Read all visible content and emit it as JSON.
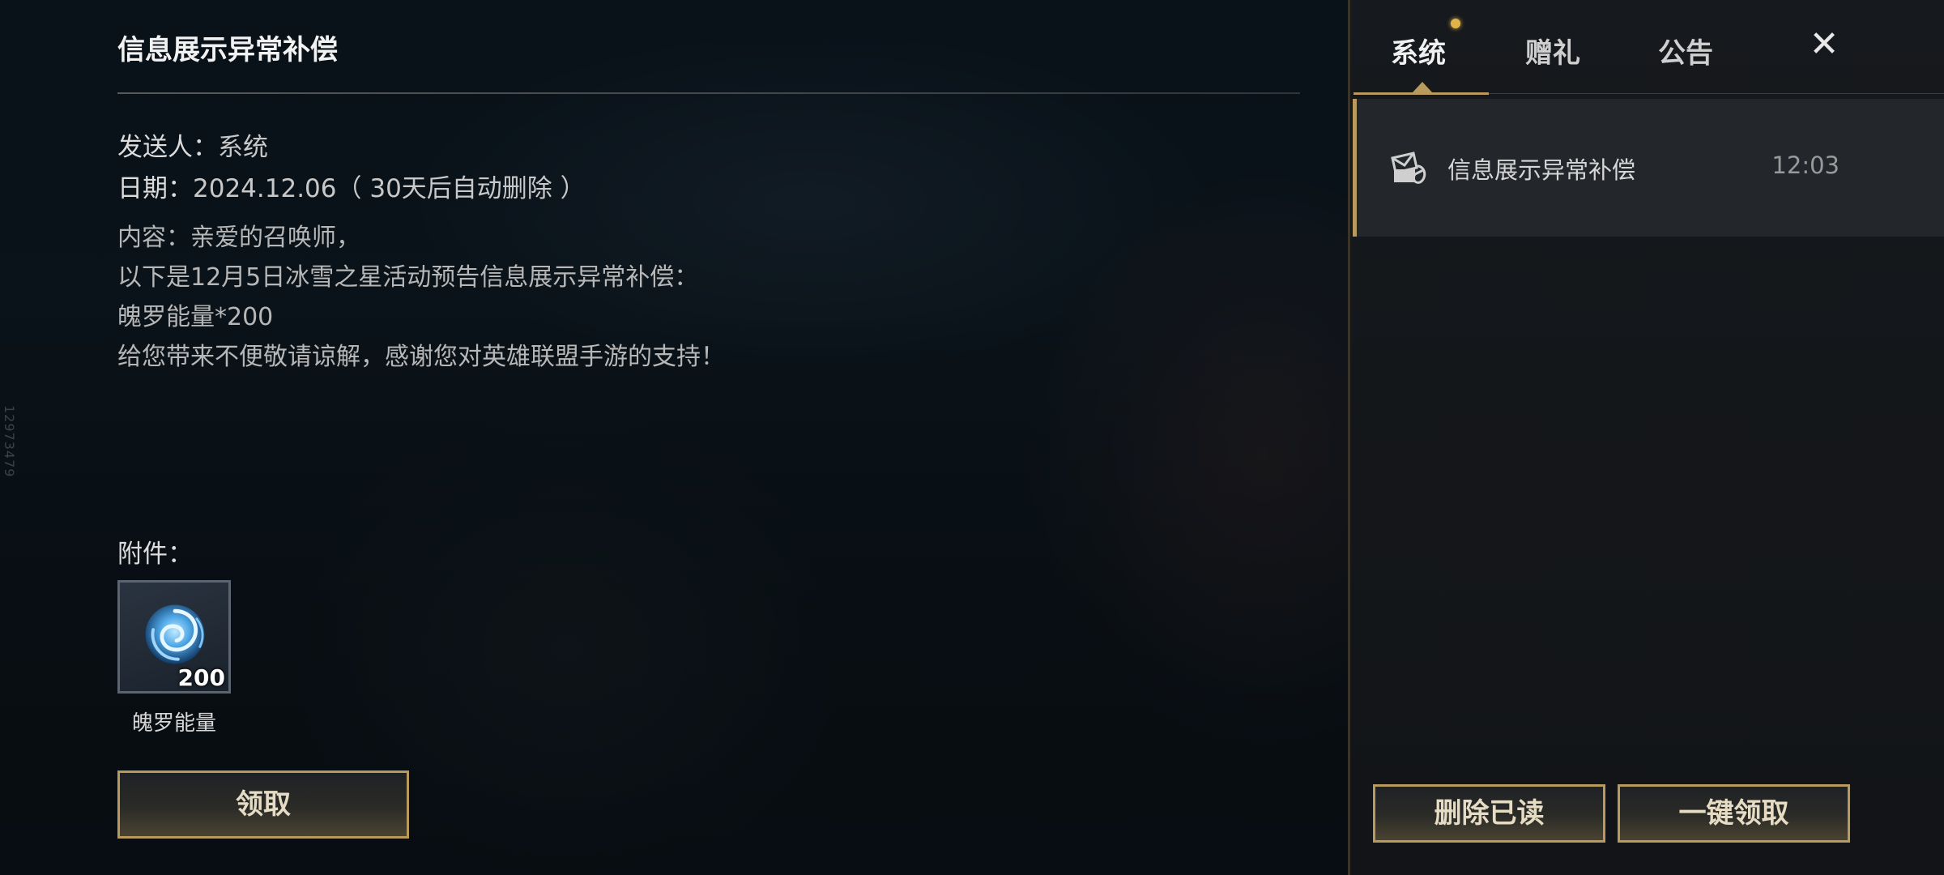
{
  "side_id": "12973479",
  "mail": {
    "title": "信息展示异常补偿",
    "sender_label": "发送人：",
    "sender": "系统",
    "date_label": "日期：",
    "date": "2024.12.06（ 30天后自动删除 ）",
    "content_lines": [
      "内容：亲爱的召唤师，",
      "以下是12月5日冰雪之星活动预告信息展示异常补偿：",
      "魄罗能量*200",
      "给您带来不便敬请谅解，感谢您对英雄联盟手游的支持！"
    ],
    "attachments_label": "附件：",
    "attachment": {
      "icon": "poro-energy-icon",
      "count": "200",
      "name": "魄罗能量"
    },
    "claim_label": "领取"
  },
  "panel": {
    "tabs": [
      "系统",
      "赠礼",
      "公告"
    ],
    "active_tab": 0,
    "close_icon": "close-icon",
    "mail_list": [
      {
        "icon": "mail-icon",
        "title": "信息展示异常补偿",
        "time": "12:03"
      }
    ],
    "delete_read_label": "删除已读",
    "claim_all_label": "一键领取"
  },
  "colors": {
    "accent_gold": "#b79a5c",
    "notification_dot": "#e0b44a"
  }
}
